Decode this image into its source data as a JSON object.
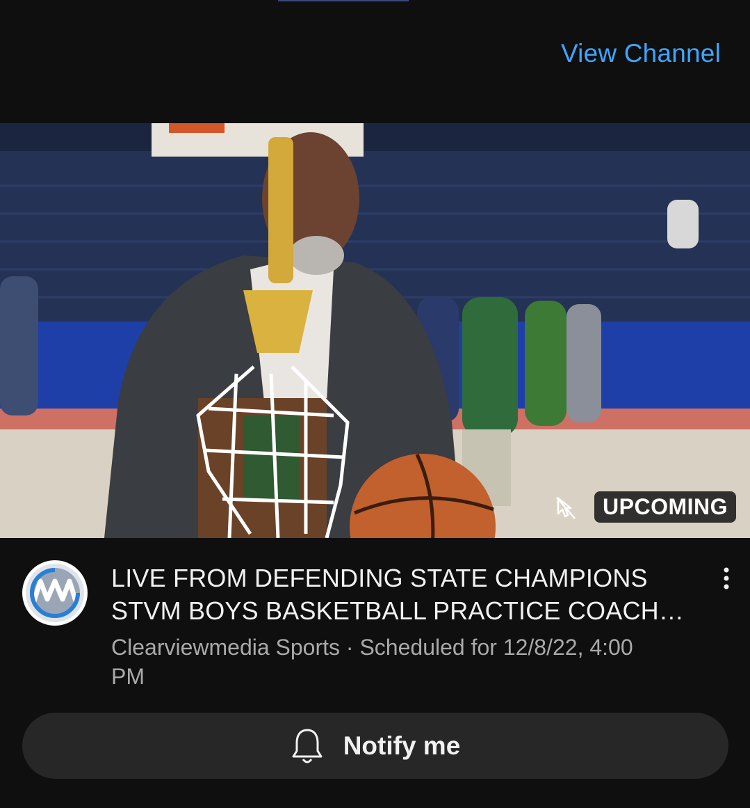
{
  "header": {
    "view_channel_label": "View Channel"
  },
  "thumbnail": {
    "badge": "UPCOMING",
    "alt": "Coach holding trophy, net and basketball"
  },
  "video": {
    "title": "LIVE FROM DEFENDING STATE CHAMPIONS STVM BOYS BASKETBALL PRACTICE COACH DRAGAN...",
    "channel": "Clearviewmedia Sports",
    "separator": " · ",
    "scheduled": "Scheduled for 12/8/22, 4:00 PM"
  },
  "notify": {
    "label": "Notify me"
  },
  "icons": {
    "avatar": "channel-logo-cvm",
    "menu": "more-vert-icon",
    "bell": "bell-icon",
    "cursor": "cursor-off-icon"
  },
  "colors": {
    "link": "#3ea6ff",
    "background": "#0f0f0f",
    "button": "#272727",
    "meta": "#aaaaaa"
  }
}
